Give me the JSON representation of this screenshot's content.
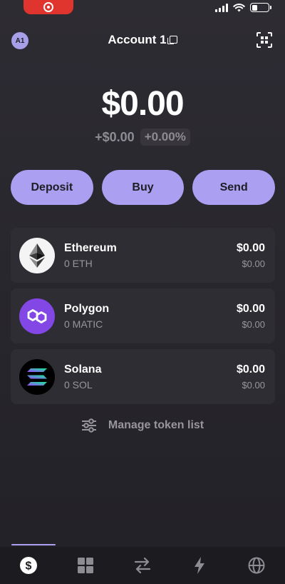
{
  "status_bar": {
    "recording": true,
    "battery_level": 0.35
  },
  "header": {
    "avatar_initials": "A1",
    "account_name": "Account 1",
    "scan_icon": "qr-scan-icon"
  },
  "portfolio": {
    "balance": "$0.00",
    "change_value": "+$0.00",
    "change_percent": "+0.00%"
  },
  "actions": [
    {
      "label": "Deposit"
    },
    {
      "label": "Buy"
    },
    {
      "label": "Send"
    }
  ],
  "tokens": [
    {
      "name": "Ethereum",
      "amount": "0 ETH",
      "usd_value": "$0.00",
      "usd_sub": "$0.00",
      "icon": "ethereum-logo-icon"
    },
    {
      "name": "Polygon",
      "amount": "0 MATIC",
      "usd_value": "$0.00",
      "usd_sub": "$0.00",
      "icon": "polygon-logo-icon"
    },
    {
      "name": "Solana",
      "amount": "0 SOL",
      "usd_value": "$0.00",
      "usd_sub": "$0.00",
      "icon": "solana-logo-icon"
    }
  ],
  "manage_tokens": {
    "label": "Manage token list",
    "icon": "sliders-icon"
  },
  "bottom_nav": [
    {
      "icon": "dollar-icon",
      "active": true
    },
    {
      "icon": "grid-icon",
      "active": false
    },
    {
      "icon": "swap-icon",
      "active": false
    },
    {
      "icon": "lightning-icon",
      "active": false
    },
    {
      "icon": "globe-icon",
      "active": false
    }
  ],
  "colors": {
    "accent": "#ab9ff2",
    "background": "#2a2930",
    "card": "#2e2d33",
    "record": "#e0342e"
  }
}
